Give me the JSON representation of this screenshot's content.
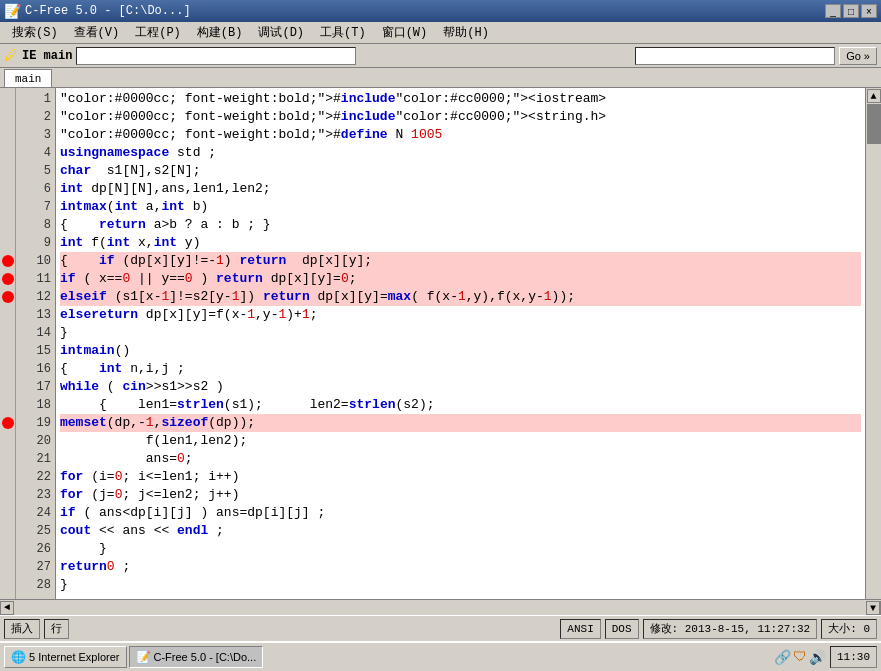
{
  "window": {
    "title": "C-Free 5.0 - [C:\\Do...]",
    "icon": "🖥"
  },
  "titlebar": {
    "text": "C-Free 5.0",
    "min_label": "_",
    "max_label": "□",
    "close_label": "×"
  },
  "menubar": {
    "items": [
      {
        "label": "搜索(S)"
      },
      {
        "label": "查看(V)"
      },
      {
        "label": "工程(P)"
      },
      {
        "label": "构建(B)"
      },
      {
        "label": "调试(D)"
      },
      {
        "label": "工具(T)"
      },
      {
        "label": "窗口(W)"
      },
      {
        "label": "帮助(H)"
      }
    ]
  },
  "filepath_bar": {
    "left_label": "IE main",
    "input_value": "",
    "go_label": "Go »"
  },
  "tab": {
    "label": "main"
  },
  "code": {
    "lines": [
      {
        "num": 1,
        "bp": false,
        "highlight": false,
        "text": "#include <iostream>"
      },
      {
        "num": 2,
        "bp": false,
        "highlight": false,
        "text": "#include <string.h>"
      },
      {
        "num": 3,
        "bp": false,
        "highlight": false,
        "text": "#define N 1005"
      },
      {
        "num": 4,
        "bp": false,
        "highlight": false,
        "text": "using namespace std ;"
      },
      {
        "num": 5,
        "bp": false,
        "highlight": false,
        "text": "char  s1[N],s2[N];"
      },
      {
        "num": 6,
        "bp": false,
        "highlight": false,
        "text": "int dp[N][N],ans,len1,len2;"
      },
      {
        "num": 7,
        "bp": false,
        "highlight": false,
        "text": "int max(int a,int b)"
      },
      {
        "num": 8,
        "bp": false,
        "highlight": false,
        "text": "{    return a>b ? a : b ; }"
      },
      {
        "num": 9,
        "bp": false,
        "highlight": false,
        "text": "int f(int x,int y)"
      },
      {
        "num": 10,
        "bp": true,
        "highlight": true,
        "text": "{    if (dp[x][y]!=-1) return  dp[x][y];"
      },
      {
        "num": 11,
        "bp": true,
        "highlight": true,
        "text": "     if ( x==0 || y==0 ) return dp[x][y]=0;"
      },
      {
        "num": 12,
        "bp": true,
        "highlight": true,
        "text": "     else if (s1[x-1]!=s2[y-1]) return dp[x][y]=max( f(x-1,y),f(x,y-1));"
      },
      {
        "num": 13,
        "bp": false,
        "highlight": false,
        "text": "     else return dp[x][y]=f(x-1,y-1)+1;"
      },
      {
        "num": 14,
        "bp": false,
        "highlight": false,
        "text": "}"
      },
      {
        "num": 15,
        "bp": false,
        "highlight": false,
        "text": "int main()"
      },
      {
        "num": 16,
        "bp": false,
        "highlight": false,
        "text": "{    int n,i,j ;"
      },
      {
        "num": 17,
        "bp": false,
        "highlight": false,
        "text": "     while ( cin>>s1>>s2 )"
      },
      {
        "num": 18,
        "bp": false,
        "highlight": false,
        "text": "     {    len1=strlen(s1);      len2=strlen(s2);"
      },
      {
        "num": 19,
        "bp": true,
        "highlight": true,
        "text": "           memset(dp,-1,sizeof(dp));"
      },
      {
        "num": 20,
        "bp": false,
        "highlight": false,
        "text": "           f(len1,len2);"
      },
      {
        "num": 21,
        "bp": false,
        "highlight": false,
        "text": "           ans=0;"
      },
      {
        "num": 22,
        "bp": false,
        "highlight": false,
        "text": "           for (i=0; i<=len1; i++)"
      },
      {
        "num": 23,
        "bp": false,
        "highlight": false,
        "text": "                for (j=0; j<=len2; j++)"
      },
      {
        "num": 24,
        "bp": false,
        "highlight": false,
        "text": "                     if ( ans<dp[i][j] ) ans=dp[i][j] ;"
      },
      {
        "num": 25,
        "bp": false,
        "highlight": false,
        "text": "           cout << ans << endl ;"
      },
      {
        "num": 26,
        "bp": false,
        "highlight": false,
        "text": "     }"
      },
      {
        "num": 27,
        "bp": false,
        "highlight": false,
        "text": "     return 0 ;"
      },
      {
        "num": 28,
        "bp": false,
        "highlight": false,
        "text": "}"
      }
    ]
  },
  "statusbar": {
    "insert_label": "插入",
    "line_label": "行",
    "ansi_label": "ANSI",
    "dos_label": "DOS",
    "modified_label": "修改: 2013-8-15,  11:27:32",
    "size_label": "大小: 0"
  },
  "taskbar": {
    "ie_label": "5 Internet Explorer",
    "cfree_label": "C-Free 5.0 - [C:\\Do...",
    "time_label": "11:30"
  }
}
